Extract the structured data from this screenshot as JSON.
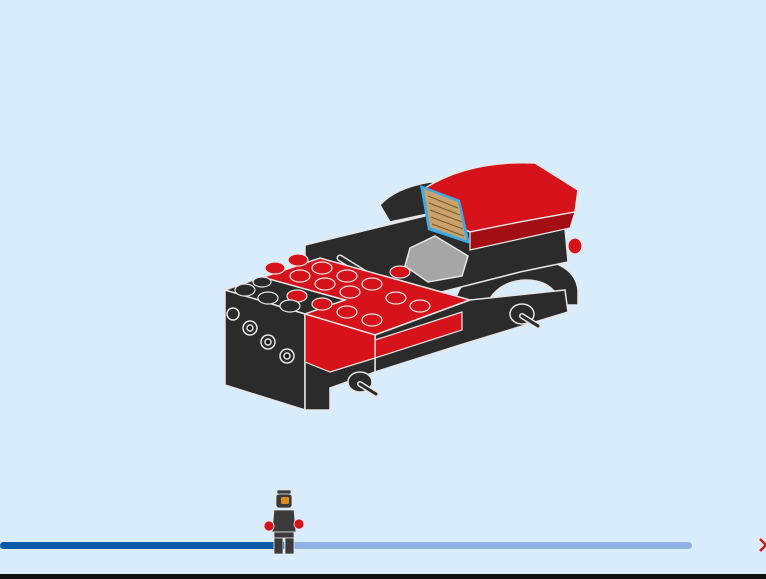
{
  "colors": {
    "background": "#d8ecfb",
    "progress_filled": "#0b5aa8",
    "progress_remaining": "#8fb2e3",
    "brick_red": "#d6121a",
    "brick_black": "#2b2b2b",
    "brick_gray": "#a6a6a6",
    "highlight_blue": "#3fa9e6",
    "tile_tan": "#c9a26c"
  },
  "progress": {
    "fraction": 0.41
  },
  "icons": {
    "progress_marker": "minifigure-icon",
    "next": "chevron-right-icon"
  }
}
